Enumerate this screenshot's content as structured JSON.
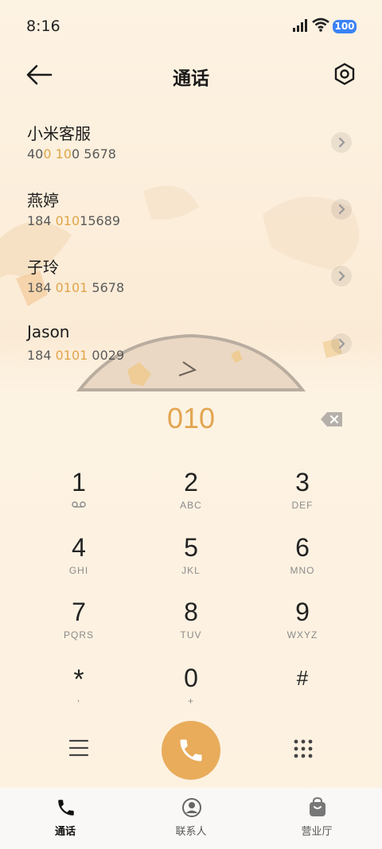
{
  "status_bar": {
    "time": "8:16",
    "battery": "100"
  },
  "header": {
    "title": "通话"
  },
  "contacts": [
    {
      "name": "小米客服",
      "number_parts": [
        "40",
        "0",
        " ",
        "10",
        "0 5678"
      ]
    },
    {
      "name": "燕婷",
      "number_parts": [
        "184 ",
        "010",
        "15689"
      ]
    },
    {
      "name": "子玲",
      "number_parts": [
        "184 ",
        "0101",
        " 5678"
      ]
    },
    {
      "name": "Jason",
      "number_parts": [
        "184 ",
        "0101",
        " 0029"
      ]
    }
  ],
  "dialer": {
    "entered_digits": "010",
    "keys": [
      {
        "digit": "1",
        "letters": ""
      },
      {
        "digit": "2",
        "letters": "ABC"
      },
      {
        "digit": "3",
        "letters": "DEF"
      },
      {
        "digit": "4",
        "letters": "GHI"
      },
      {
        "digit": "5",
        "letters": "JKL"
      },
      {
        "digit": "6",
        "letters": "MNO"
      },
      {
        "digit": "7",
        "letters": "PQRS"
      },
      {
        "digit": "8",
        "letters": "TUV"
      },
      {
        "digit": "9",
        "letters": "WXYZ"
      },
      {
        "digit": "*",
        "letters": ","
      },
      {
        "digit": "0",
        "letters": "+"
      },
      {
        "digit": "#",
        "letters": ""
      }
    ]
  },
  "bottom_nav": [
    {
      "label": "通话",
      "icon": "phone-icon",
      "active": true
    },
    {
      "label": "联系人",
      "icon": "contact-icon",
      "active": false
    },
    {
      "label": "营业厅",
      "icon": "shop-bag-icon",
      "active": false
    }
  ],
  "colors": {
    "accent": "#e8ac5b",
    "highlight": "#e0a54a",
    "background": "#fdf3e3"
  }
}
